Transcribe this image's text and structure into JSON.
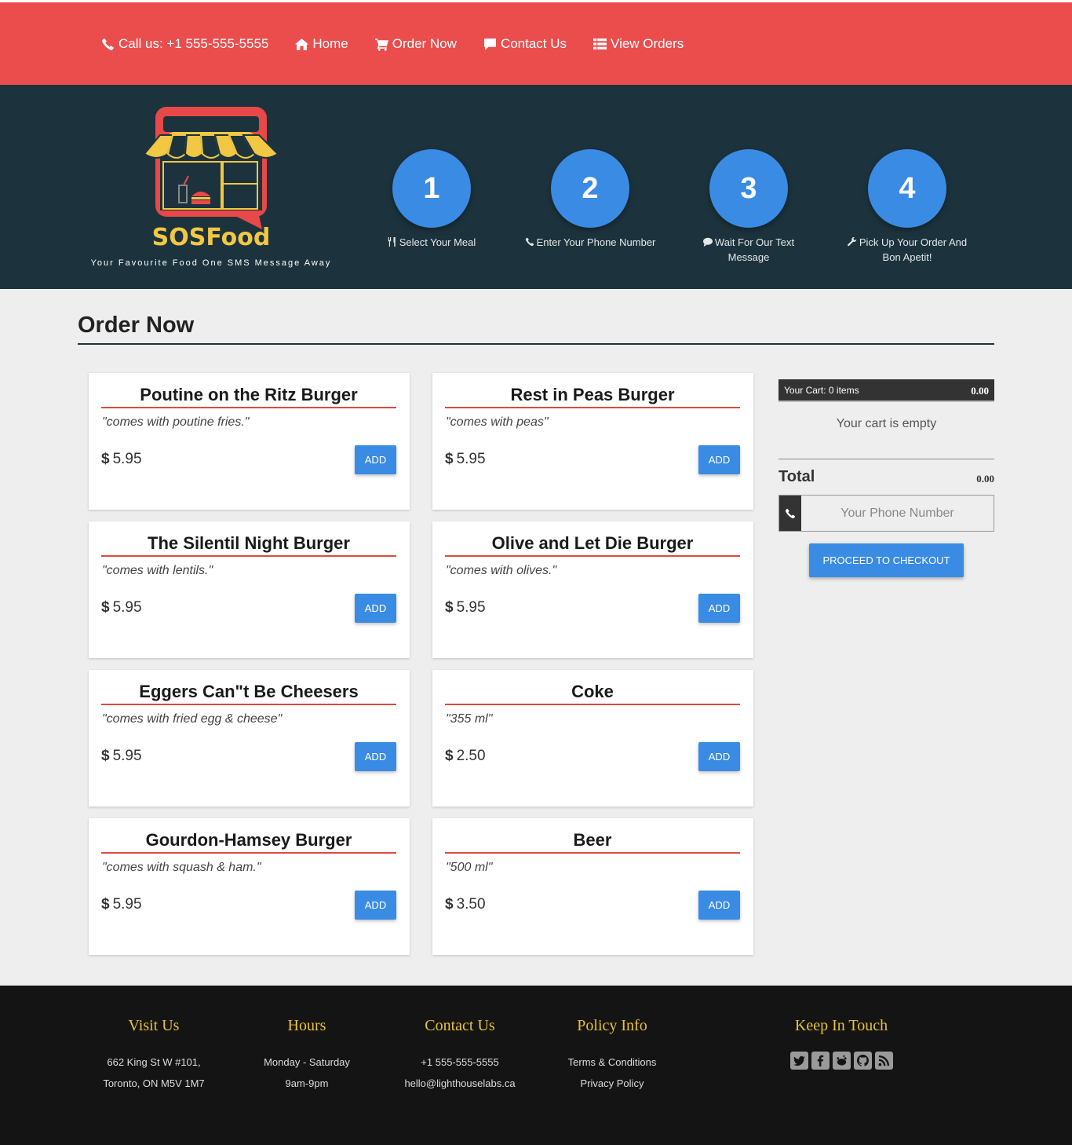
{
  "nav": {
    "call": "Call us: +1 555-555-5555",
    "home": "Home",
    "order": "Order Now",
    "contact": "Contact Us",
    "view_orders": "View Orders"
  },
  "brand": {
    "name": "SOSFood",
    "tagline": "Your Favourite Food One SMS Message Away"
  },
  "steps": [
    {
      "number": "1",
      "label": "Select Your Meal",
      "icon": "cutlery-icon"
    },
    {
      "number": "2",
      "label": "Enter Your Phone Number",
      "icon": "phone-icon"
    },
    {
      "number": "3",
      "label": "Wait For Our Text Message",
      "icon": "comment-icon"
    },
    {
      "number": "4",
      "label": "Pick Up Your Order And Bon Apetit!",
      "icon": "wrench-icon"
    }
  ],
  "order_section": {
    "title": "Order Now"
  },
  "menu": [
    {
      "name": "Poutine on the Ritz Burger",
      "desc": "\"comes with poutine fries.\"",
      "currency": "$",
      "price": "5.95",
      "button": "ADD"
    },
    {
      "name": "Rest in Peas Burger",
      "desc": "\"comes with peas\"",
      "currency": "$",
      "price": "5.95",
      "button": "ADD"
    },
    {
      "name": "The Silentil Night Burger",
      "desc": "\"comes with lentils.\"",
      "currency": "$",
      "price": "5.95",
      "button": "ADD"
    },
    {
      "name": "Olive and Let Die Burger",
      "desc": "\"comes with olives.\"",
      "currency": "$",
      "price": "5.95",
      "button": "ADD"
    },
    {
      "name": "Eggers Can\"t Be Cheesers",
      "desc": "\"comes with fried egg & cheese\"",
      "currency": "$",
      "price": "5.95",
      "button": "ADD"
    },
    {
      "name": "Coke",
      "desc": "\"355 ml\"",
      "currency": "$",
      "price": "2.50",
      "button": "ADD"
    },
    {
      "name": "Gourdon-Hamsey Burger",
      "desc": "\"comes with squash & ham.\"",
      "currency": "$",
      "price": "5.95",
      "button": "ADD"
    },
    {
      "name": "Beer",
      "desc": "\"500 ml\"",
      "currency": "$",
      "price": "3.50",
      "button": "ADD"
    }
  ],
  "cart": {
    "header_label": "Your Cart: 0 items",
    "header_amount": "0.00",
    "empty_text": "Your cart is empty",
    "total_label": "Total",
    "total_amount": "0.00",
    "phone_placeholder": "Your Phone Number",
    "checkout_label": "PROCEED TO CHECKOUT"
  },
  "footer": {
    "visit": {
      "title": "Visit Us",
      "line1": "662 King St W #101,",
      "line2": "Toronto, ON M5V 1M7"
    },
    "hours": {
      "title": "Hours",
      "line1": "Monday - Saturday",
      "line2": "9am-9pm"
    },
    "contact": {
      "title": "Contact Us",
      "phone": "+1 555-555-5555",
      "email": "hello@lighthouselabs.ca"
    },
    "policy": {
      "title": "Policy Info",
      "terms": "Terms & Conditions",
      "privacy": "Privacy Policy"
    },
    "keep": {
      "title": "Keep In Touch",
      "icons": [
        "twitter-icon",
        "facebook-icon",
        "reddit-icon",
        "github-icon",
        "rss-icon"
      ]
    }
  },
  "colors": {
    "nav_bg": "#eb4d4d",
    "hero_bg": "#1c333d",
    "accent_blue": "#3a8be3",
    "footer_bg": "#141414",
    "footer_heading": "#e9c234",
    "card_rule": "#e04a3f"
  }
}
